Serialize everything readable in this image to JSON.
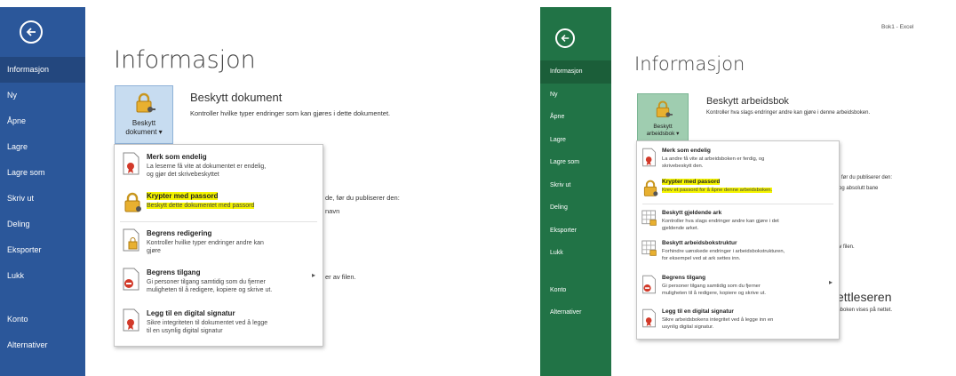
{
  "word": {
    "nav": [
      {
        "label": "Informasjon"
      },
      {
        "label": "Ny"
      },
      {
        "label": "Åpne"
      },
      {
        "label": "Lagre"
      },
      {
        "label": "Lagre som"
      },
      {
        "label": "Skriv ut"
      },
      {
        "label": "Deling"
      },
      {
        "label": "Eksporter"
      },
      {
        "label": "Lukk"
      },
      {
        "label": "Konto"
      },
      {
        "label": "Alternativer"
      }
    ],
    "page_title": "Informasjon",
    "protect": {
      "button_label_1": "Beskytt",
      "button_label_2": "dokument ▾",
      "title": "Beskytt dokument",
      "description": "Kontroller hvilke typer endringer som kan gjøres i dette dokumentet."
    },
    "background": {
      "inspect_text": "de, før du publiserer den:",
      "inspect_sub": "navn",
      "versions_text": "er av filen."
    },
    "menu": [
      {
        "title": "Merk som endelig",
        "desc": "La leserne få vite at dokumentet er endelig,\nog gjør det skrivebeskyttet"
      },
      {
        "title": "Krypter med passord",
        "desc": "Beskytt dette dokumentet med passord"
      },
      {
        "title": "Begrens redigering",
        "desc": "Kontroller hvilke typer endringer andre kan\ngjøre"
      },
      {
        "title": "Begrens tilgang",
        "desc": "Gi personer tilgang samtidig som du fjerner\nmuligheten til å redigere, kopiere og skrive ut."
      },
      {
        "title": "Legg til en digital signatur",
        "desc": "Sikre integriteten til dokumentet ved å legge\ntil en usynlig digital signatur"
      }
    ]
  },
  "excel": {
    "window_title": "Bok1 - Excel",
    "nav": [
      {
        "label": "Informasjon"
      },
      {
        "label": "Ny"
      },
      {
        "label": "Åpne"
      },
      {
        "label": "Lagre"
      },
      {
        "label": "Lagre som"
      },
      {
        "label": "Skriv ut"
      },
      {
        "label": "Deling"
      },
      {
        "label": "Eksporter"
      },
      {
        "label": "Lukk"
      },
      {
        "label": "Konto"
      },
      {
        "label": "Alternativer"
      }
    ],
    "page_title": "Informasjon",
    "protect": {
      "button_label_1": "Beskytt",
      "button_label_2": "arbeidsbok ▾",
      "title": "Beskytt arbeidsbok",
      "description": "Kontroller hva slags endringer andre kan gjøre i denne arbeidsboken."
    },
    "background": {
      "inspect_text": "le, før du publiserer den:",
      "inspect_sub": "n og absolutt bane",
      "versions_text": "av filen.",
      "browser_title": "ettleseren",
      "browser_sub": "tsboken vises på nettet."
    },
    "menu": [
      {
        "title": "Merk som endelig",
        "desc": "La andre få vite at arbeidsboken er ferdig, og\nskrivebeskytt den."
      },
      {
        "title": "Krypter med passord",
        "desc": "Krev et passord for å åpne denne arbeidsboken."
      },
      {
        "title": "Beskytt gjeldende ark",
        "desc": "Kontroller hva slags endringer andre kan gjøre i det\ngjeldende arket."
      },
      {
        "title": "Beskytt arbeidsbokstruktur",
        "desc": "Forhindre uønskede endringer i arbeidsbokstrukturen,\nfor eksempel ved at ark settes inn."
      },
      {
        "title": "Begrens tilgang",
        "desc": "Gi personer tilgang samtidig som du fjerner\nmuligheten til å redigere, kopiere og skrive ut."
      },
      {
        "title": "Legg til en digital signatur",
        "desc": "Sikre arbeidsbokens integritet ved å legge inn en\nusynlig digital signatur."
      }
    ]
  },
  "colors": {
    "word_blue": "#2b579a",
    "excel_green": "#217346",
    "highlight": "#f4f400"
  }
}
